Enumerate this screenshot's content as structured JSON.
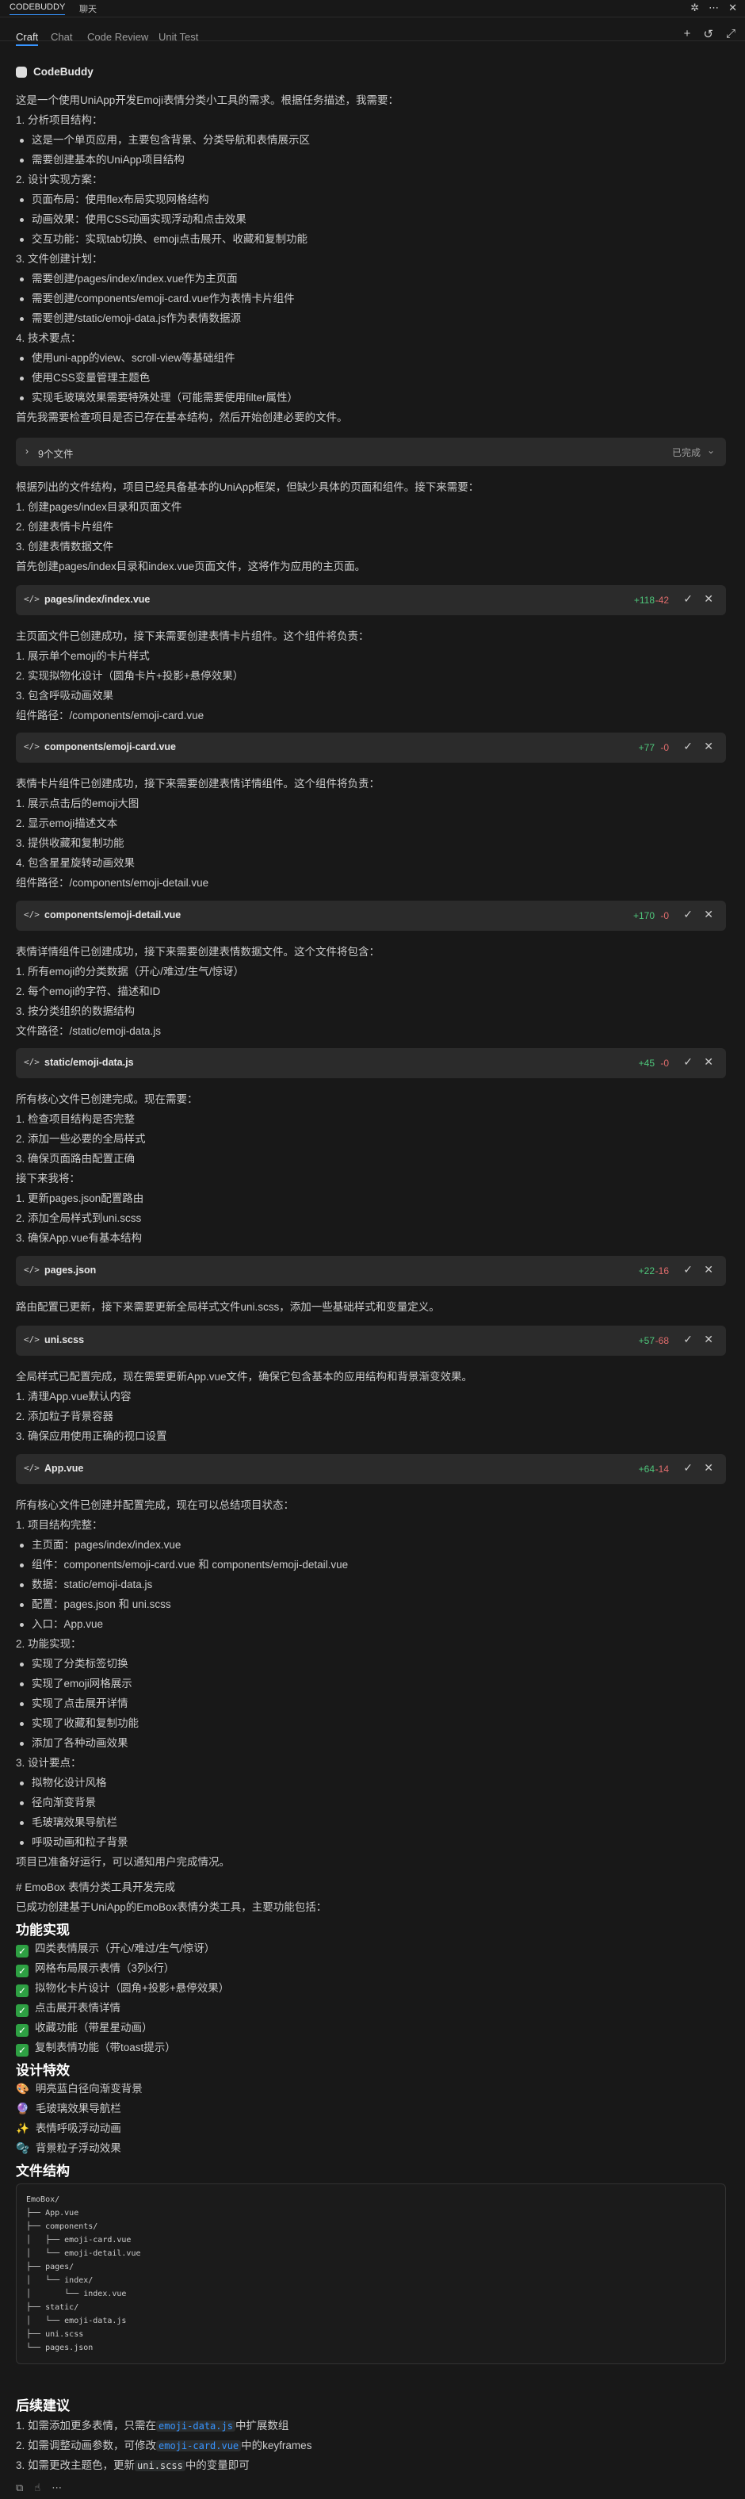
{
  "top_tabs": [
    "CODEBUDDY",
    "聊天"
  ],
  "nav_tabs": [
    "Craft",
    "Chat",
    "Code Review",
    "Unit Test"
  ],
  "assistant_name": "CodeBuddy",
  "intro": {
    "l1": "这是一个使用UniApp开发Emoji表情分类小工具的需求。根据任务描述，我需要：",
    "l2": "1. 分析项目结构：",
    "b1": "这是一个单页应用，主要包含背景、分类导航和表情展示区",
    "b2": "需要创建基本的UniApp项目结构",
    "l3": "2. 设计实现方案：",
    "b3": "页面布局：使用flex布局实现网格结构",
    "b4": "动画效果：使用CSS动画实现浮动和点击效果",
    "b5": "交互功能：实现tab切换、emoji点击展开、收藏和复制功能",
    "l4": "3. 文件创建计划：",
    "b6": "需要创建/pages/index/index.vue作为主页面",
    "b7": "需要创建/components/emoji-card.vue作为表情卡片组件",
    "b8": "需要创建/static/emoji-data.js作为表情数据源",
    "l5": "4. 技术要点：",
    "b9": "使用uni-app的view、scroll-view等基础组件",
    "b10": "使用CSS变量管理主题色",
    "b11": "实现毛玻璃效果需要特殊处理（可能需要使用filter属性）",
    "l6": "首先我需要检查项目是否已存在基本结构，然后开始创建必要的文件。"
  },
  "files_bar": {
    "label": "9个文件",
    "status": "已完成"
  },
  "s1": {
    "l1": "根据列出的文件结构，项目已经具备基本的UniApp框架，但缺少具体的页面和组件。接下来需要：",
    "l2": "1. 创建pages/index目录和页面文件",
    "l3": "2. 创建表情卡片组件",
    "l4": "3. 创建表情数据文件",
    "l5": "首先创建pages/index目录和index.vue页面文件，这将作为应用的主页面。"
  },
  "cards": [
    {
      "name": "pages/index/index.vue",
      "add": "+118",
      "del": "-42"
    },
    {
      "name": "components/emoji-card.vue",
      "add": "+77",
      "del": "-0"
    },
    {
      "name": "components/emoji-detail.vue",
      "add": "+170",
      "del": "-0"
    },
    {
      "name": "static/emoji-data.js",
      "add": "+45",
      "del": "-0"
    },
    {
      "name": "pages.json",
      "add": "+22",
      "del": "-16"
    },
    {
      "name": "uni.scss",
      "add": "+57",
      "del": "-68"
    },
    {
      "name": "App.vue",
      "add": "+64",
      "del": "-14"
    }
  ],
  "s2": {
    "l1": "主页面文件已创建成功，接下来需要创建表情卡片组件。这个组件将负责：",
    "l2": "1. 展示单个emoji的卡片样式",
    "l3": "2. 实现拟物化设计（圆角卡片+投影+悬停效果）",
    "l4": "3. 包含呼吸动画效果",
    "l5": "组件路径：/components/emoji-card.vue"
  },
  "s3": {
    "l1": "表情卡片组件已创建成功，接下来需要创建表情详情组件。这个组件将负责：",
    "l2": "1. 展示点击后的emoji大图",
    "l3": "2. 显示emoji描述文本",
    "l4": "3. 提供收藏和复制功能",
    "l5": "4. 包含星星旋转动画效果",
    "l6": "组件路径：/components/emoji-detail.vue"
  },
  "s4": {
    "l1": "表情详情组件已创建成功，接下来需要创建表情数据文件。这个文件将包含：",
    "l2": "1. 所有emoji的分类数据（开心/难过/生气/惊讶）",
    "l3": "2. 每个emoji的字符、描述和ID",
    "l4": "3. 按分类组织的数据结构",
    "l5": "文件路径：/static/emoji-data.js"
  },
  "s5": {
    "l1": "所有核心文件已创建完成。现在需要：",
    "l2": "1. 检查项目结构是否完整",
    "l3": "2. 添加一些必要的全局样式",
    "l4": "3. 确保页面路由配置正确",
    "l5": "接下来我将：",
    "l6": "1. 更新pages.json配置路由",
    "l7": "2. 添加全局样式到uni.scss",
    "l8": "3. 确保App.vue有基本结构"
  },
  "s6": {
    "l1": "路由配置已更新，接下来需要更新全局样式文件uni.scss，添加一些基础样式和变量定义。"
  },
  "s7": {
    "l1": "全局样式已配置完成，现在需要更新App.vue文件，确保它包含基本的应用结构和背景渐变效果。",
    "l2": "1. 清理App.vue默认内容",
    "l3": "2. 添加粒子背景容器",
    "l4": "3. 确保应用使用正确的视口设置"
  },
  "s8": {
    "l1": "所有核心文件已创建并配置完成，现在可以总结项目状态：",
    "l2": "1. 项目结构完整：",
    "b1": "主页面：pages/index/index.vue",
    "b2": "组件：components/emoji-card.vue 和 components/emoji-detail.vue",
    "b3": "数据：static/emoji-data.js",
    "b4": "配置：pages.json 和 uni.scss",
    "b5": "入口：App.vue",
    "l3": "2. 功能实现：",
    "b6": "实现了分类标签切换",
    "b7": "实现了emoji网格展示",
    "b8": "实现了点击展开详情",
    "b9": "实现了收藏和复制功能",
    "b10": "添加了各种动画效果",
    "l4": "3. 设计要点：",
    "b11": "拟物化设计风格",
    "b12": "径向渐变背景",
    "b13": "毛玻璃效果导航栏",
    "b14": "呼吸动画和粒子背景",
    "l5": "项目已准备好运行，可以通知用户完成情况。"
  },
  "summary": {
    "title": "# EmoBox 表情分类工具开发完成",
    "l1": "已成功创建基于UniApp的EmoBox表情分类工具，主要功能包括：",
    "h1": "功能实现",
    "f1": "四类表情展示（开心/难过/生气/惊讶）",
    "f2": "网格布局展示表情（3列x行）",
    "f3": "拟物化卡片设计（圆角+投影+悬停效果）",
    "f4": "点击展开表情详情",
    "f5": "收藏功能（带星星动画）",
    "f6": "复制表情功能（带toast提示）",
    "h2": "设计特效",
    "e1": "明亮蓝白径向渐变背景",
    "e2": "毛玻璃效果导航栏",
    "e3": "表情呼吸浮动动画",
    "e4": "背景粒子浮动效果",
    "h3": "文件结构",
    "tree": [
      "EmoBox/",
      "├── App.vue",
      "├── components/",
      "│   ├── emoji-card.vue",
      "│   └── emoji-detail.vue",
      "├── pages/",
      "│   └── index/",
      "│       └── index.vue",
      "├── static/",
      "│   └── emoji-data.js",
      "├── uni.scss",
      "└── pages.json"
    ],
    "h4": "后续建议",
    "s1a": "1. 如需添加更多表情，只需在",
    "s1code": "emoji-data.js",
    "s1b": "中扩展数组",
    "s2a": "2. 如需调整动画参数，可修改",
    "s2code": "emoji-card.vue",
    "s2b": "中的keyframes",
    "s3a": "3. 如需更改主题色，更新",
    "s3code": "uni.scss",
    "s3b": "中的变量即可"
  }
}
